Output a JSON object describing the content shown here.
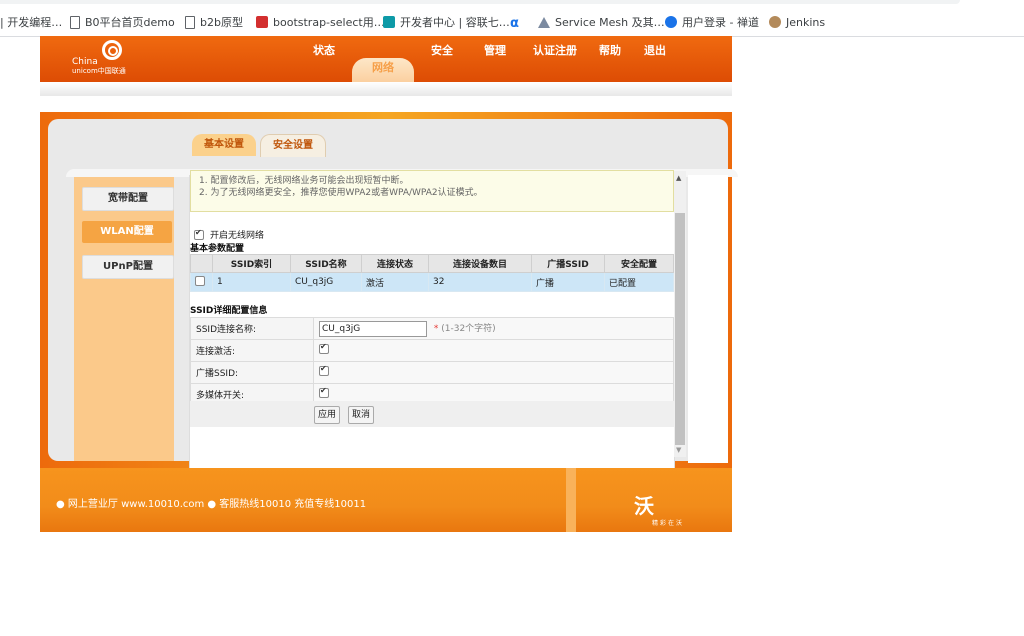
{
  "bookmarks": [
    {
      "label": "| 开发编程…",
      "icon": "none"
    },
    {
      "label": "B0平台首页demo",
      "icon": "doc-icon"
    },
    {
      "label": "b2b原型",
      "icon": "doc-icon"
    },
    {
      "label": "bootstrap-select用…",
      "icon": "red-c-icon"
    },
    {
      "label": "开发者中心 | 容联七…",
      "icon": "teal-icon"
    },
    {
      "label": "",
      "icon": "alpha-icon"
    },
    {
      "label": "Service Mesh 及其…",
      "icon": "mesh-icon"
    },
    {
      "label": "用户登录 - 禅道",
      "icon": "blue-globe-icon"
    },
    {
      "label": "Jenkins",
      "icon": "jenkins-icon"
    }
  ],
  "header": {
    "logo_line1": "China",
    "logo_line2": "unicom中国联通",
    "nav": [
      "状态",
      "网络",
      "安全",
      "管理",
      "认证注册",
      "帮助",
      "退出"
    ],
    "active_nav": "网络"
  },
  "tabs": [
    "基本设置",
    "安全设置"
  ],
  "sidebar": [
    "宽带配置",
    "WLAN配置",
    "UPnP配置"
  ],
  "notice": [
    "1. 配置修改后，无线网络业务可能会出现短暂中断。",
    "2. 为了无线网络更安全，推荐您使用WPA2或者WPA/WPA2认证模式。"
  ],
  "enable_wireless_label": "开启无线网络",
  "basic_section_title": "基本参数配置",
  "ssid_table": {
    "headers": [
      "",
      "SSID索引",
      "SSID名称",
      "连接状态",
      "连接设备数目",
      "广播SSID",
      "安全配置"
    ],
    "row": [
      "",
      "1",
      "CU_q3jG",
      "激活",
      "32",
      "广播",
      "已配置"
    ]
  },
  "detail_section_title": "SSID详细配置信息",
  "detail": {
    "ssid_name_label": "SSID连接名称:",
    "ssid_name_value": "CU_q3jG",
    "ssid_hint_star": "*",
    "ssid_hint": "(1-32个字符)",
    "enable_label": "连接激活:",
    "broadcast_label": "广播SSID:",
    "multimedia_label": "多媒体开关:"
  },
  "buttons": {
    "apply": "应用",
    "cancel": "取消"
  },
  "footer": {
    "text": "● 网上营业厅 www.10010.com ● 客服热线10010 充值专线10011",
    "brand": "沃",
    "brand_sub": "精彩在沃"
  },
  "colors": {
    "brand_orange": "#ed6a0c",
    "active_tab": "#fbd18c",
    "sidebar_active": "#f5a443",
    "row_highlight": "#cde6f7"
  }
}
